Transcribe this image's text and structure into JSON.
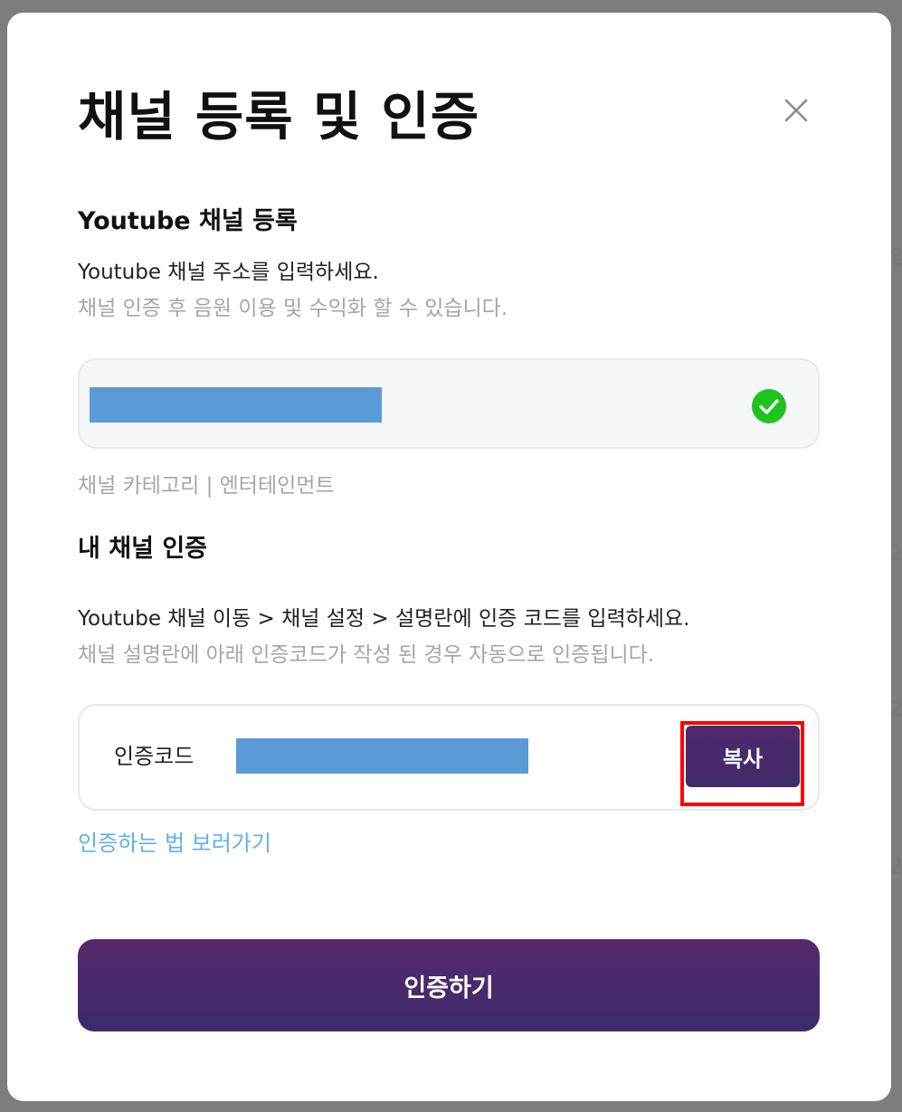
{
  "background_peek": [
    "인",
    "2",
    "2",
    "2"
  ],
  "modal": {
    "title": "채널 등록 및 인증",
    "close_icon": "close-icon"
  },
  "youtube_register": {
    "heading": "Youtube 채널 등록",
    "instruction": "Youtube 채널 주소를 입력하세요.",
    "note": "채널 인증 후 음원 이용 및 수익화 할 수 있습니다.",
    "status_icon": "check-circle-icon",
    "category_text": "채널 카테고리 | 엔터테인먼트"
  },
  "channel_verify": {
    "heading": "내 채널 인증",
    "instruction": "Youtube 채널 이동 > 채널 설정 > 설명란에 인증 코드를 입력하세요.",
    "note": "채널 설명란에 아래 인증코드가 작성 된 경우 자동으로 인증됩니다.",
    "code_label": "인증코드",
    "copy_button": "복사",
    "howto_link": "인증하는 법 보러가기",
    "submit_button": "인증하기"
  },
  "colors": {
    "accent": "#4a2a6c",
    "check_green": "#1ec31e",
    "link_blue": "#62b1ea",
    "highlight_red": "#ff0000",
    "redaction_blue": "#5b9bd5"
  }
}
